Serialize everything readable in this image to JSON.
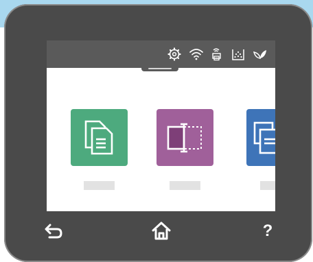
{
  "colors": {
    "bezel": "#4a4a4a",
    "status_bar": "#5a5a5a",
    "copy_tile": "#4daa7e",
    "id_copy_tile": "#a0609a",
    "scan_tile": "#3e74b8",
    "tile_label_placeholder": "#e2e2e2"
  },
  "status_bar": {
    "icons": [
      "settings-icon",
      "wifi-icon",
      "wifi-direct-icon",
      "supplies-icon",
      "eco-icon"
    ]
  },
  "home": {
    "apps": [
      {
        "icon": "copy-icon",
        "label": ""
      },
      {
        "icon": "id-copy-icon",
        "label": ""
      },
      {
        "icon": "scan-icon",
        "label": ""
      }
    ]
  },
  "nav": {
    "help_label": "?"
  }
}
